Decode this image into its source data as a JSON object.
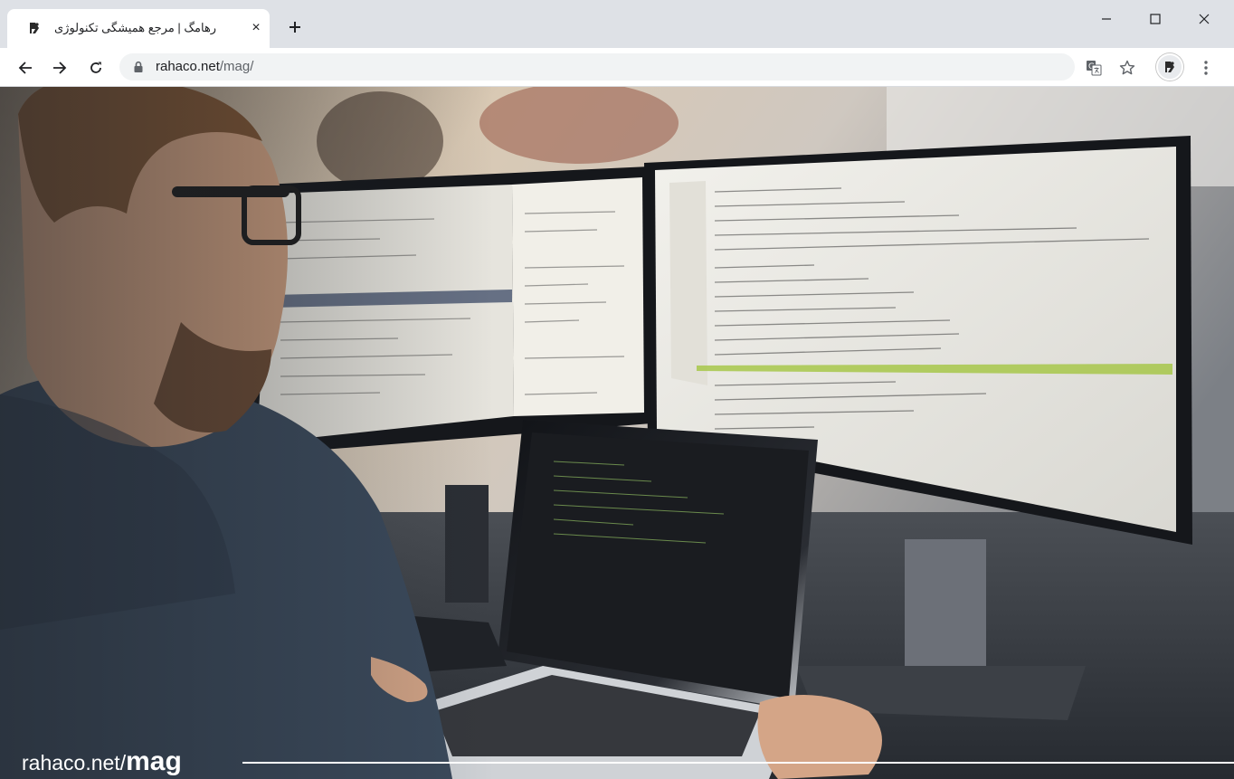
{
  "browser": {
    "tab": {
      "title": "رهامگ | مرجع همیشگی تکنولوژی",
      "favicon": "rahaco-logo-icon",
      "close": "×"
    },
    "new_tab_icon": "plus-icon",
    "window_controls": [
      "minimize-icon",
      "maximize-icon",
      "close-icon"
    ],
    "nav": [
      "back-icon",
      "forward-icon",
      "reload-icon"
    ],
    "address": {
      "host": "rahaco.net",
      "path": "/mag/"
    },
    "toolbar_icons": [
      "translate-icon",
      "bookmark-star-icon",
      "profile-avatar",
      "menu-kebab-icon"
    ]
  },
  "page": {
    "hero_image": "developer-working-at-multiple-monitors-photo",
    "caption": {
      "site": "rahaco.net/",
      "section": "mag"
    }
  },
  "colors": {
    "tabstrip": "#dee1e6",
    "toolbar": "#ffffff",
    "omnibox": "#f1f3f4"
  }
}
